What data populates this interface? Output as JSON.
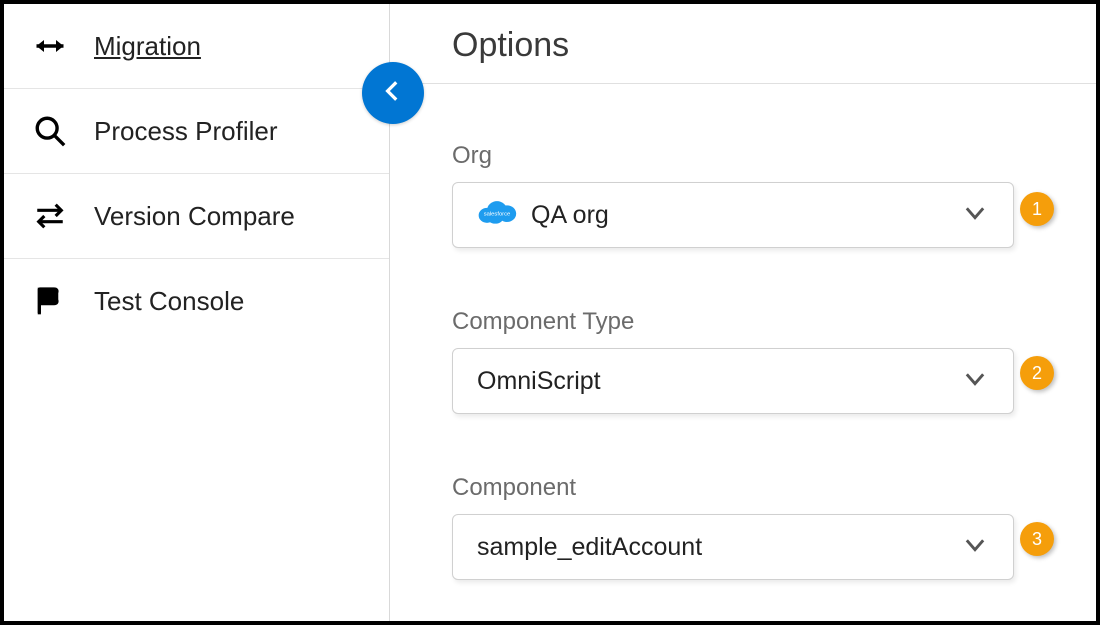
{
  "sidebar": {
    "items": [
      {
        "label": "Migration",
        "icon": "migration-icon",
        "active": true
      },
      {
        "label": "Process Profiler",
        "icon": "search-icon",
        "active": false
      },
      {
        "label": "Version Compare",
        "icon": "swap-icon",
        "active": false
      },
      {
        "label": "Test Console",
        "icon": "flag-icon",
        "active": false
      }
    ]
  },
  "main": {
    "title": "Options",
    "fields": {
      "org": {
        "label": "Org",
        "value": "QA org",
        "badge": "1"
      },
      "componentType": {
        "label": "Component Type",
        "value": "OmniScript",
        "badge": "2"
      },
      "component": {
        "label": "Component",
        "value": "sample_editAccount",
        "badge": "3"
      }
    }
  },
  "colors": {
    "accent": "#0176d3",
    "badge": "#f59e0b"
  }
}
